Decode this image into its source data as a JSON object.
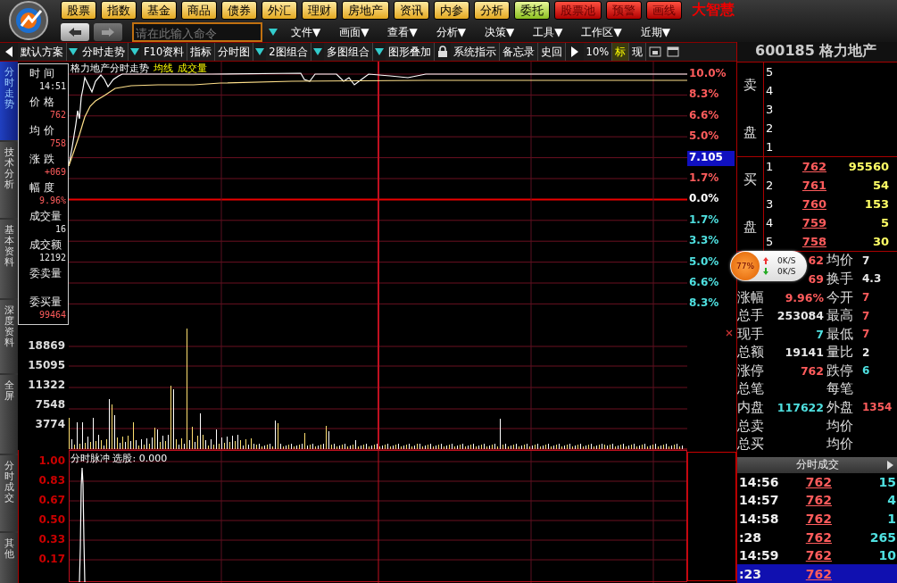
{
  "top_buttons": [
    {
      "label": "股票",
      "kind": "gold"
    },
    {
      "label": "指数",
      "kind": "gold"
    },
    {
      "label": "基金",
      "kind": "gold"
    },
    {
      "label": "商品",
      "kind": "gold"
    },
    {
      "label": "债券",
      "kind": "gold"
    },
    {
      "label": "外汇",
      "kind": "gold"
    },
    {
      "label": "理财",
      "kind": "gold"
    },
    {
      "label": "房地产",
      "kind": "gold"
    },
    {
      "label": "资讯",
      "kind": "gold"
    },
    {
      "label": "内参",
      "kind": "gold"
    },
    {
      "label": "分析",
      "kind": "gold"
    },
    {
      "label": "委托",
      "kind": "green"
    },
    {
      "label": "股票池",
      "kind": "red"
    },
    {
      "label": "预警",
      "kind": "red"
    },
    {
      "label": "画线",
      "kind": "red"
    }
  ],
  "brand": "大智慧",
  "command": {
    "placeholder": "请在此输入命令"
  },
  "menus": [
    "文件▼",
    "画面▼",
    "查看▼",
    "分析▼",
    "决策▼",
    "工具▼",
    "工作区▼",
    "近期▼"
  ],
  "toolbar": [
    {
      "label": "默认方案",
      "dropdown": true,
      "highlight": false
    },
    {
      "label": "分时走势",
      "dropdown": true,
      "highlight": false
    },
    {
      "label": "F10资料",
      "dropdown": false,
      "highlight": false
    },
    {
      "label": "指标",
      "dropdown": false,
      "highlight": false
    },
    {
      "label": "分时图",
      "dropdown": true,
      "highlight": false
    },
    {
      "label": "2图组合",
      "dropdown": true,
      "highlight": false
    },
    {
      "label": "多图组合",
      "dropdown": true,
      "highlight": false
    },
    {
      "label": "图形叠加",
      "dropdown": false,
      "highlight": false
    },
    {
      "label": "系统指示",
      "dropdown": false,
      "highlight": false
    },
    {
      "label": "备忘录",
      "dropdown": false,
      "highlight": false
    },
    {
      "label": "史回",
      "dropdown": false,
      "highlight": false
    },
    {
      "label": "10%",
      "dropdown": false,
      "highlight": false
    },
    {
      "label": "标",
      "dropdown": false,
      "highlight": true
    },
    {
      "label": "现",
      "dropdown": false,
      "highlight": false
    }
  ],
  "side_tabs": [
    {
      "label": "分时走势",
      "selected": true
    },
    {
      "label": "技术分析",
      "selected": false
    },
    {
      "label": "基本资料",
      "selected": false
    },
    {
      "label": "深度资料",
      "selected": false
    },
    {
      "label": "全屏",
      "selected": false
    },
    {
      "label": "分时成交",
      "selected": false
    },
    {
      "label": "其他",
      "selected": false
    }
  ],
  "chart_title": {
    "name": "格力地产分时走势",
    "avg": "均线",
    "volume": "成交量"
  },
  "info": [
    {
      "label": "时 间",
      "value": "14:51",
      "kind": "plain"
    },
    {
      "label": "价 格",
      "value": "762",
      "kind": "up"
    },
    {
      "label": "均 价",
      "value": "758",
      "kind": "up"
    },
    {
      "label": "涨 跌",
      "value": "+069",
      "kind": "up"
    },
    {
      "label": "幅 度",
      "value": "9.96%",
      "kind": "up"
    },
    {
      "label": "成交量",
      "value": "16",
      "kind": "plain"
    },
    {
      "label": "成交额",
      "value": "12192",
      "kind": "plain"
    },
    {
      "label": "委卖量",
      "kind": "plain"
    },
    {
      "label": "委买量",
      "value": "99464",
      "kind": "up"
    }
  ],
  "pct_axis": [
    {
      "label": "10.0%",
      "kind": "up"
    },
    {
      "label": "8.3%",
      "kind": "up"
    },
    {
      "label": "6.6%",
      "kind": "up"
    },
    {
      "label": "5.0%",
      "kind": "up"
    },
    {
      "label": "7.105",
      "kind": "cursor"
    },
    {
      "label": "1.7%",
      "kind": "up"
    },
    {
      "label": "0.0%",
      "kind": "flat"
    },
    {
      "label": "1.7%",
      "kind": "down"
    },
    {
      "label": "3.3%",
      "kind": "down"
    },
    {
      "label": "5.0%",
      "kind": "down"
    },
    {
      "label": "6.6%",
      "kind": "down"
    },
    {
      "label": "8.3%",
      "kind": "down"
    }
  ],
  "volume_axis": [
    "18869",
    "15095",
    "11322",
    "7548",
    "3774"
  ],
  "indicator": {
    "title": "分时脉冲  选股: 0.000",
    "axis": [
      "1.00",
      "0.83",
      "0.67",
      "0.50",
      "0.33",
      "0.17"
    ]
  },
  "quote": {
    "header": "600185 格力地产",
    "sell_label": [
      "卖",
      "盘"
    ],
    "buy_label": [
      "买",
      "盘"
    ],
    "sell": [
      {
        "level": "5"
      },
      {
        "level": "4"
      },
      {
        "level": "3"
      },
      {
        "level": "2"
      },
      {
        "level": "1"
      }
    ],
    "buy": [
      {
        "level": "1",
        "price": "762",
        "volume": "95560"
      },
      {
        "level": "2",
        "price": "761",
        "volume": "54"
      },
      {
        "level": "3",
        "price": "760",
        "volume": "153"
      },
      {
        "level": "4",
        "price": "759",
        "volume": "5"
      },
      {
        "level": "5",
        "price": "758",
        "volume": "30"
      }
    ],
    "stats": [
      {
        "left": {
          "value": "62",
          "kind": "up"
        },
        "right": {
          "label": "均价",
          "value": "7",
          "kind": "plain"
        }
      },
      {
        "left": {
          "value": "69",
          "kind": "up"
        },
        "right": {
          "label": "换手",
          "value": "4.3",
          "kind": "plain"
        }
      },
      {
        "left": {
          "label": "涨幅",
          "value": "9.96%",
          "kind": "up"
        },
        "right": {
          "label": "今开",
          "value": "7",
          "kind": "up"
        }
      },
      {
        "left": {
          "label": "总手",
          "value": "253084",
          "kind": "plain"
        },
        "right": {
          "label": "最高",
          "value": "7",
          "kind": "up"
        }
      },
      {
        "left": {
          "label": "现手",
          "value": "7",
          "kind": "down"
        },
        "right": {
          "label": "最低",
          "value": "7",
          "kind": "up"
        }
      },
      {
        "left": {
          "label": "总额",
          "value": "19141",
          "kind": "plain"
        },
        "right": {
          "label": "量比",
          "value": "2",
          "kind": "plain"
        }
      },
      {
        "left": {
          "label": "涨停",
          "value": "762",
          "kind": "up"
        },
        "right": {
          "label": "跌停",
          "value": "6",
          "kind": "down"
        }
      },
      {
        "left": {
          "label": "总笔"
        },
        "right": {
          "label": "每笔"
        }
      },
      {
        "left": {
          "label": "内盘",
          "value": "117622",
          "kind": "down"
        },
        "right": {
          "label": "外盘",
          "value": "1354",
          "kind": "up"
        }
      },
      {
        "left": {
          "label": "总卖"
        },
        "right": {
          "label": "均价"
        }
      },
      {
        "left": {
          "label": "总买"
        },
        "right": {
          "label": "均价"
        }
      }
    ],
    "trades_title": "分时成交",
    "trades": [
      {
        "time": "14:56",
        "price": "762",
        "volume": "15",
        "selected": false
      },
      {
        "time": "14:57",
        "price": "762",
        "volume": "4",
        "selected": false
      },
      {
        "time": "14:58",
        "price": "762",
        "volume": "1",
        "selected": false
      },
      {
        "time": ":28",
        "price": "762",
        "volume": "265",
        "selected": false
      },
      {
        "time": "14:59",
        "price": "762",
        "volume": "10",
        "selected": false
      },
      {
        "time": ":23",
        "price": "762",
        "selected": true
      }
    ]
  },
  "net_widget": {
    "percent": "77%",
    "up": "0K/S",
    "down": "0K/S"
  }
}
